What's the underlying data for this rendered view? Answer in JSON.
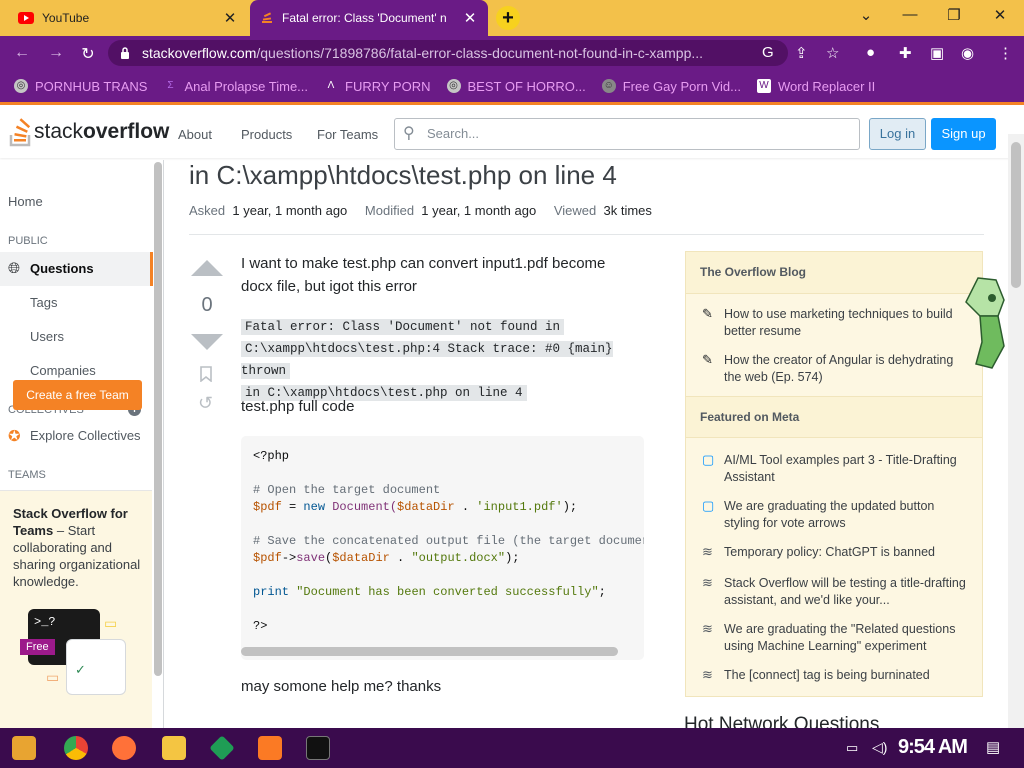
{
  "browser": {
    "tabs": [
      {
        "title": "YouTube"
      },
      {
        "title": "Fatal error: Class 'Document' n"
      }
    ],
    "url_domain": "stackoverflow.com",
    "url_path": "/questions/71898786/fatal-error-class-document-not-found-in-c-xampp...",
    "bookmarks": [
      {
        "label": "PORNHUB TRANS"
      },
      {
        "label": "Anal Prolapse Time..."
      },
      {
        "label": "FURRY PORN"
      },
      {
        "label": "BEST OF HORRO..."
      },
      {
        "label": "Free Gay Porn Vid..."
      },
      {
        "label": "Word Replacer II"
      }
    ]
  },
  "header": {
    "logo_light": "stack",
    "logo_bold": "overflow",
    "nav": [
      "About",
      "Products",
      "For Teams"
    ],
    "search_placeholder": "Search...",
    "login": "Log in",
    "signup": "Sign up"
  },
  "leftnav": {
    "home": "Home",
    "public": "PUBLIC",
    "questions": "Questions",
    "tags": "Tags",
    "users": "Users",
    "companies": "Companies",
    "collectives": "COLLECTIVES",
    "explore_collectives": "Explore Collectives",
    "teams": "TEAMS",
    "teams_title": "Stack Overflow for Teams",
    "teams_text": " – Start collaborating and sharing organizational knowledge.",
    "free_badge": "Free",
    "create_team": "Create a free Team"
  },
  "question": {
    "title": "in C:\\xampp\\htdocs\\test.php on line 4",
    "asked_label": "Asked",
    "asked_value": "1 year, 1 month ago",
    "modified_label": "Modified",
    "modified_value": "1 year, 1 month ago",
    "viewed_label": "Viewed",
    "viewed_value": "3k times",
    "votes": "0",
    "body1": "I want to make test.php can convert input1.pdf become docx file, but igot this error",
    "error_line1": "Fatal error: Class 'Document' not found in",
    "error_line2": "C:\\xampp\\htdocs\\test.php:4 Stack trace: #0 {main} thrown",
    "error_line3": "in C:\\xampp\\htdocs\\test.php on line 4",
    "body2": "test.php full code",
    "code": {
      "l1": "<?php",
      "l2": "# Open the target document",
      "l3a": "$pdf",
      "l3b": " = ",
      "l3c": "new",
      "l3d": " Document(",
      "l3e": "$dataDir",
      "l3f": " . ",
      "l3g": "'input1.pdf'",
      "l3h": ");",
      "l4": "# Save the concatenated output file (the target documer",
      "l5a": "$pdf",
      "l5b": "->",
      "l5c": "save",
      "l5d": "(",
      "l5e": "$dataDir",
      "l5f": " . ",
      "l5g": "\"output.docx\"",
      "l5h": ");",
      "l6a": "print",
      "l6b": " ",
      "l6c": "\"Document has been converted successfully\"",
      "l6d": ";",
      "l7": "?>"
    },
    "body3": "may somone help me? thanks"
  },
  "widget": {
    "blog_heading": "The Overflow Blog",
    "blog_items": [
      "How to use marketing techniques to build better resume",
      "How the creator of Angular is dehydrating the web (Ep. 574)"
    ],
    "meta_heading": "Featured on Meta",
    "meta_items": [
      "AI/ML Tool examples part 3 - Title-Drafting Assistant",
      "We are graduating the updated button styling for vote arrows",
      "Temporary policy: ChatGPT is banned",
      "Stack Overflow will be testing a title-drafting assistant, and we'd like your...",
      "We are graduating the \"Related questions using Machine Learning\" experiment",
      "The [connect] tag is being burninated"
    ],
    "hot_network": "Hot Network Questions"
  },
  "taskbar": {
    "clock": "9:54 AM"
  },
  "colors": {
    "tab_bar": "#f3c14a",
    "browser_purple": "#6a1b86",
    "so_orange": "#f48225",
    "so_blue": "#0a95ff",
    "widget_bg": "#fdf7e2"
  }
}
